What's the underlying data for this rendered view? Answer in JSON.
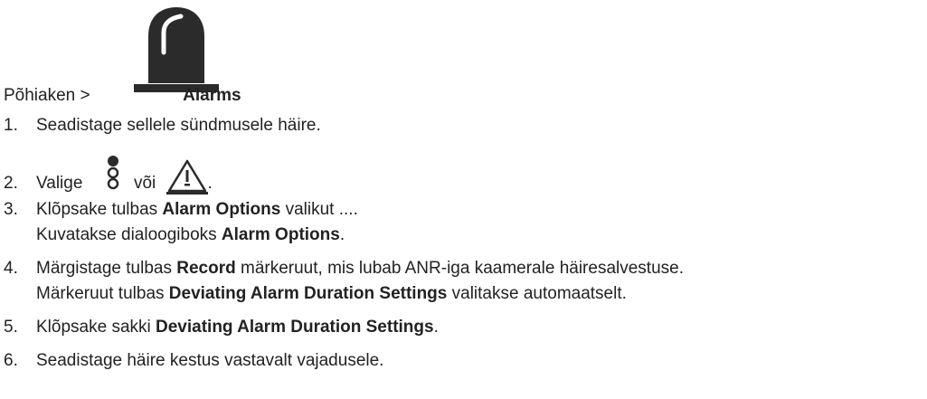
{
  "breadcrumb": {
    "prefix": "Põhiaken >",
    "target": "Alarms",
    "icon": "alarm-beacon-icon"
  },
  "steps": [
    {
      "number": "1.",
      "parts": [
        "Seadistage sellele sündmusele häire."
      ]
    },
    {
      "number": "2.",
      "parts": [
        "Valige",
        "või",
        "."
      ],
      "icons": [
        "stacked-circles-icon",
        "warning-triangle-icon"
      ]
    },
    {
      "number": "3.",
      "parts": [
        "Klõpsake tulbas ",
        "Alarm Options",
        " valikut ...."
      ]
    },
    {
      "cont": [
        "Kuvatakse dialoogiboks ",
        "Alarm Options",
        "."
      ]
    },
    {
      "number": "4.",
      "parts": [
        "Märgistage tulbas ",
        "Record",
        " märkeruut, mis lubab ANR-iga kaamerale häiresalvestuse."
      ]
    },
    {
      "cont": [
        "Märkeruut tulbas ",
        "Deviating Alarm Duration Settings",
        " valitakse automaatselt."
      ]
    },
    {
      "number": "5.",
      "parts": [
        "Klõpsake sakki ",
        "Deviating Alarm Duration Settings",
        "."
      ]
    },
    {
      "number": "6.",
      "parts": [
        "Seadistage häire kestus vastavalt vajadusele."
      ]
    }
  ]
}
